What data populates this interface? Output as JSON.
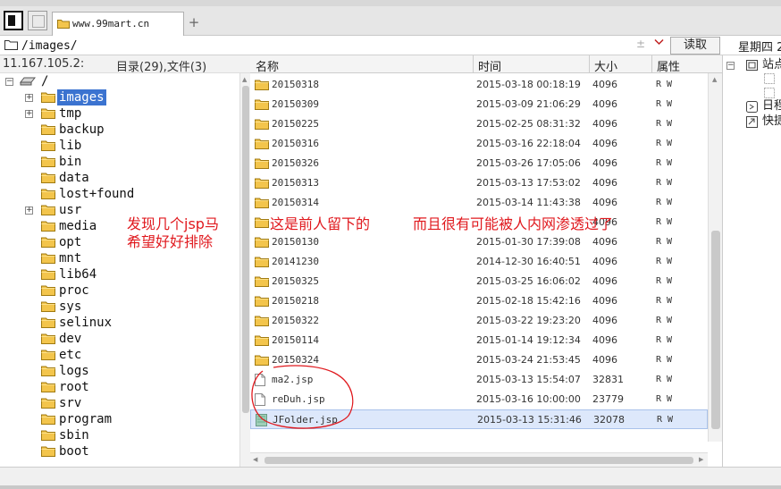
{
  "tab": {
    "title": "www.99mart.cn",
    "new_tab": "+"
  },
  "address": {
    "path": "/images/"
  },
  "toolbar": {
    "plus_minus": "±",
    "read_label": "读取",
    "weekday": "星期四 2"
  },
  "info": {
    "ip": "11.167.105.2:",
    "counts": "目录(29),文件(3)"
  },
  "tree": {
    "root": "/",
    "items": [
      "images",
      "tmp",
      "backup",
      "lib",
      "bin",
      "data",
      "lost+found",
      "usr",
      "media",
      "opt",
      "mnt",
      "lib64",
      "proc",
      "sys",
      "selinux",
      "dev",
      "etc",
      "logs",
      "root",
      "srv",
      "program",
      "sbin",
      "boot"
    ],
    "selected": "images"
  },
  "columns": {
    "name": "名称",
    "time": "时间",
    "size": "大小",
    "attr": "属性"
  },
  "files": [
    {
      "name": "20150318",
      "time": "2015-03-18 00:18:19",
      "size": "4096",
      "attr": "R W",
      "type": "folder"
    },
    {
      "name": "20150309",
      "time": "2015-03-09 21:06:29",
      "size": "4096",
      "attr": "R W",
      "type": "folder"
    },
    {
      "name": "20150225",
      "time": "2015-02-25 08:31:32",
      "size": "4096",
      "attr": "R W",
      "type": "folder"
    },
    {
      "name": "20150316",
      "time": "2015-03-16 22:18:04",
      "size": "4096",
      "attr": "R W",
      "type": "folder"
    },
    {
      "name": "20150326",
      "time": "2015-03-26 17:05:06",
      "size": "4096",
      "attr": "R W",
      "type": "folder"
    },
    {
      "name": "20150313",
      "time": "2015-03-13 17:53:02",
      "size": "4096",
      "attr": "R W",
      "type": "folder"
    },
    {
      "name": "20150314",
      "time": "2015-03-14 11:43:38",
      "size": "4096",
      "attr": "R W",
      "type": "folder"
    },
    {
      "name": "",
      "time": "",
      "size": "4096",
      "attr": "R W",
      "type": "folder"
    },
    {
      "name": "20150130",
      "time": "2015-01-30 17:39:08",
      "size": "4096",
      "attr": "R W",
      "type": "folder"
    },
    {
      "name": "20141230",
      "time": "2014-12-30 16:40:51",
      "size": "4096",
      "attr": "R W",
      "type": "folder"
    },
    {
      "name": "20150325",
      "time": "2015-03-25 16:06:02",
      "size": "4096",
      "attr": "R W",
      "type": "folder"
    },
    {
      "name": "20150218",
      "time": "2015-02-18 15:42:16",
      "size": "4096",
      "attr": "R W",
      "type": "folder"
    },
    {
      "name": "20150322",
      "time": "2015-03-22 19:23:20",
      "size": "4096",
      "attr": "R W",
      "type": "folder"
    },
    {
      "name": "20150114",
      "time": "2015-01-14 19:12:34",
      "size": "4096",
      "attr": "R W",
      "type": "folder"
    },
    {
      "name": "20150324",
      "time": "2015-03-24 21:53:45",
      "size": "4096",
      "attr": "R W",
      "type": "folder"
    },
    {
      "name": "ma2.jsp",
      "time": "2015-03-13 15:54:07",
      "size": "32831",
      "attr": "R W",
      "type": "file"
    },
    {
      "name": "reDuh.jsp",
      "time": "2015-03-16 10:00:00",
      "size": "23779",
      "attr": "R W",
      "type": "file"
    },
    {
      "name": "JFolder.jsp",
      "time": "2015-03-13 15:31:46",
      "size": "32078",
      "attr": "R W",
      "type": "file"
    }
  ],
  "side": {
    "sites": "站点",
    "schedule": "日程",
    "shortcuts": "快捷"
  },
  "annotations": {
    "line1": "发现几个jsp马",
    "line2": "希望好好排除",
    "middle": "这是前人留下的",
    "right": "而且很有可能被人内网渗透过了"
  },
  "colors": {
    "annotation": "#e0191e",
    "selection": "#3b73d0",
    "folder": "#f3c54c"
  }
}
